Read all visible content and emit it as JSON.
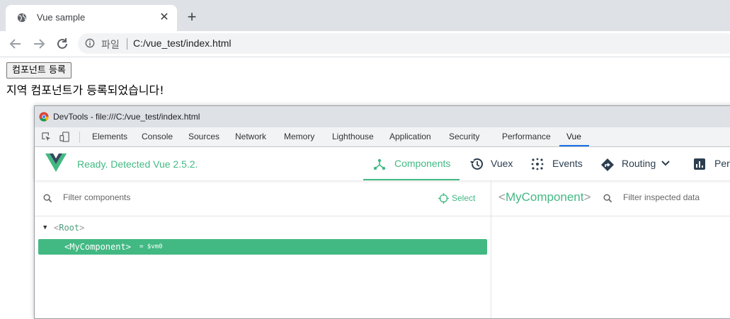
{
  "browser": {
    "tab_title": "Vue sample",
    "omnibox_scheme": "파일",
    "omnibox_url": "C:/vue_test/index.html"
  },
  "page": {
    "button_label": "컴포넌트 등록",
    "message": "지역 컴포넌트가 등록되었습니다!"
  },
  "devtools": {
    "window_title": "DevTools - file:///C:/vue_test/index.html",
    "tabs": [
      "Elements",
      "Console",
      "Sources",
      "Network",
      "Memory",
      "Lighthouse",
      "Application",
      "Security",
      "Performance",
      "Vue"
    ],
    "active_tab": "Vue",
    "vue": {
      "status": "Ready. Detected Vue 2.5.2.",
      "nav": [
        "Components",
        "Vuex",
        "Events",
        "Routing",
        "Perf"
      ],
      "active_nav": "Components",
      "filter_placeholder": "Filter components",
      "select_label": "Select",
      "tree": {
        "root": "Root",
        "selected": "MyComponent",
        "selected_ref": "= $vm0"
      },
      "inspected_component": "MyComponent",
      "inspected_filter_placeholder": "Filter inspected data"
    },
    "colors": {
      "vue_green": "#42b983",
      "vue_dark": "#35495e"
    }
  }
}
